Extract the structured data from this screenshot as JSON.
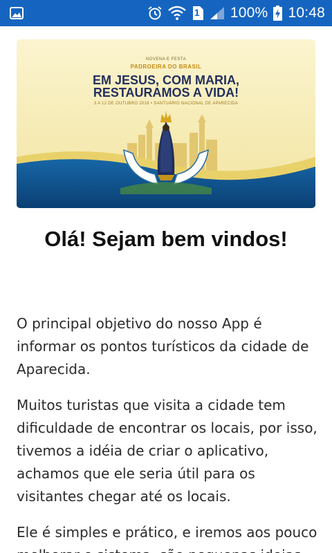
{
  "status_bar": {
    "battery": "100%",
    "time": "10:48",
    "sim_slot": "1",
    "icons": [
      "image-icon",
      "alarm-icon",
      "wifi-icon",
      "sim-icon",
      "signal-icon",
      "battery-charging-icon"
    ]
  },
  "banner": {
    "pre_title": "NOVENA E FESTA",
    "subtitle": "PADROEIRA DO BRASIL",
    "title_line1": "EM JESUS, COM MARIA,",
    "title_line2": "RESTAURAMOS A VIDA!",
    "dates": "3 A 12 DE OUTUBRO 2018 • SANTUÁRIO NACIONAL DE APARECIDA"
  },
  "main": {
    "greeting": "Olá! Sejam bem vindos!",
    "paragraphs": [
      "O principal objetivo do nosso App é informar os pontos turísticos da cidade de Aparecida.",
      "Muitos turistas que visita a cidade tem dificuldade de encontrar os locais, por isso, tivemos a idéia de criar o aplicativo, achamos que ele seria útil para os visitantes chegar até os locais.",
      "Ele é simples e prático, e iremos aos pouco melhorar o sistema, são pequenas ideias"
    ]
  },
  "colors": {
    "status_bar": "#1565c0",
    "banner_sky": "#f6eebf",
    "banner_wave": "#0d4f8a",
    "title": "#23305e"
  }
}
